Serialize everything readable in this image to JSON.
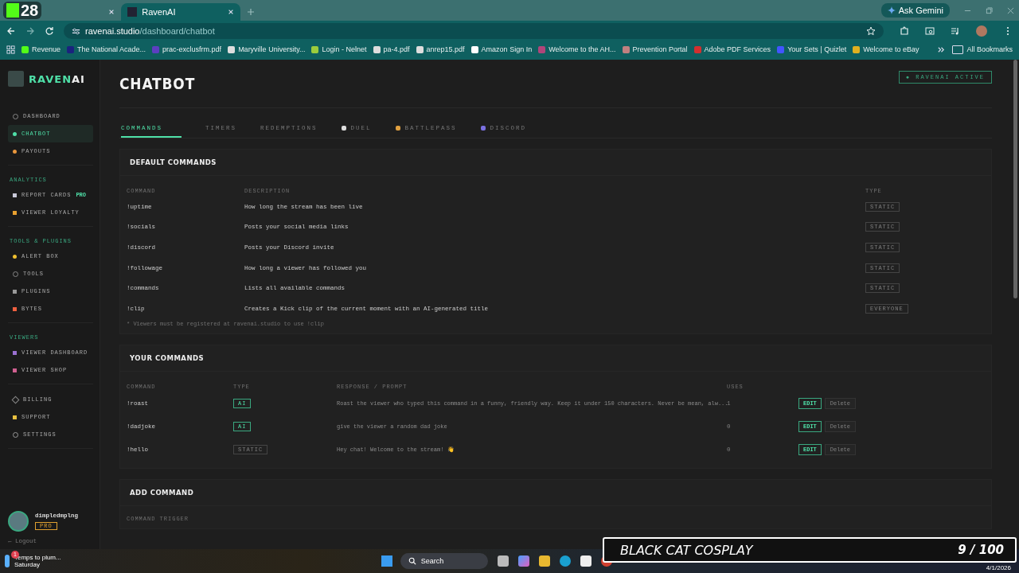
{
  "browser": {
    "tabs": [
      {
        "selected": false
      },
      {
        "title": "RavenAI",
        "selected": true
      }
    ],
    "url": {
      "host": "ravenai.studio",
      "path": "/dashboard/chatbot"
    },
    "ask_button": "Ask Gemini",
    "bookmarks": [
      "Revenue",
      "The National Acade...",
      "prac-exclusfrm.pdf",
      "Maryville University...",
      "Login - Nelnet",
      "pa-4.pdf",
      "anrep15.pdf",
      "Amazon Sign In",
      "Welcome to the AH...",
      "Prevention Portal",
      "Adobe PDF Services",
      "Your Sets | Quizlet",
      "Welcome to eBay"
    ],
    "all_bookmarks": "All Bookmarks"
  },
  "stream_badge": {
    "count": "28"
  },
  "sidebar": {
    "brand": {
      "part_1": "RAVEN",
      "part_2": "AI"
    },
    "sections": [
      {
        "items": [
          {
            "label": "DASHBOARD",
            "selected": false
          },
          {
            "label": "CHATBOT",
            "selected": true
          },
          {
            "label": "PAYOUTS",
            "selected": false
          }
        ]
      },
      {
        "heading": "ANALYTICS",
        "items": [
          {
            "label": "REPORT CARDS",
            "selected": false,
            "badge": "PRO"
          },
          {
            "label": "VIEWER LOYALTY",
            "selected": false
          }
        ]
      },
      {
        "heading": "TOOLS & PLUGINS",
        "items": [
          {
            "label": "ALERT BOX",
            "selected": false
          },
          {
            "label": "TOOLS",
            "selected": false
          },
          {
            "label": "PLUGINS",
            "selected": false
          },
          {
            "label": "BYTES",
            "selected": false
          }
        ]
      },
      {
        "heading": "VIEWERS",
        "items": [
          {
            "label": "VIEWER DASHBOARD",
            "selected": false
          },
          {
            "label": "VIEWER SHOP",
            "selected": false
          }
        ]
      },
      {
        "items": [
          {
            "label": "BILLING",
            "selected": false
          },
          {
            "label": "SUPPORT",
            "selected": false
          },
          {
            "label": "SETTINGS",
            "selected": false
          }
        ]
      }
    ],
    "user": {
      "name": "dimpledmplng",
      "plan": "PRO",
      "logout": "← Logout"
    }
  },
  "main": {
    "title": "CHATBOT",
    "status": "● RAVENAI ACTIVE",
    "tabs": [
      {
        "label": "COMMANDS",
        "selected": true
      },
      {
        "label": "TIMERS",
        "selected": false
      },
      {
        "label": "REDEMPTIONS",
        "selected": false
      },
      {
        "label": "DUEL",
        "selected": false
      },
      {
        "label": "BATTLEPASS",
        "selected": false
      },
      {
        "label": "DISCORD",
        "selected": false
      }
    ],
    "default_commands": {
      "title": "DEFAULT COMMANDS",
      "columns": [
        "COMMAND",
        "DESCRIPTION",
        "TYPE"
      ],
      "rows": [
        {
          "command": "!uptime",
          "description": "How long the stream has been live",
          "type": "STATIC"
        },
        {
          "command": "!socials",
          "description": "Posts your social media links",
          "type": "STATIC"
        },
        {
          "command": "!discord",
          "description": "Posts your Discord invite",
          "type": "STATIC"
        },
        {
          "command": "!followage",
          "description": "How long a viewer has followed you",
          "type": "STATIC"
        },
        {
          "command": "!commands",
          "description": "Lists all available commands",
          "type": "STATIC"
        },
        {
          "command": "!clip",
          "description": "Creates a Kick clip of the current moment with an AI-generated title",
          "type": "EVERYONE"
        }
      ],
      "note": "* Viewers must be registered at ravenai.studio to use !clip"
    },
    "your_commands": {
      "title": "YOUR COMMANDS",
      "columns": [
        "COMMAND",
        "TYPE",
        "RESPONSE / PROMPT",
        "USES"
      ],
      "rows": [
        {
          "command": "!roast",
          "type": "AI",
          "kind": "ai",
          "response": "Roast the viewer who typed this command in a funny, friendly way. Keep it under 150 characters. Never be mean, alw...",
          "uses": "1",
          "edit": "EDIT",
          "delete": "Delete"
        },
        {
          "command": "!dadjoke",
          "type": "AI",
          "kind": "ai",
          "response": "give the viewer a random dad joke",
          "uses": "0",
          "edit": "EDIT",
          "delete": "Delete"
        },
        {
          "command": "!hello",
          "type": "STATIC",
          "kind": "static",
          "response": "Hey chat! Welcome to the stream! 👋",
          "uses": "0",
          "edit": "EDIT",
          "delete": "Delete"
        }
      ]
    },
    "add_command": {
      "title": "ADD COMMAND",
      "field_label": "COMMAND TRIGGER"
    }
  },
  "taskbar": {
    "weather": {
      "title": "Temps to plum...",
      "subtitle": "Saturday",
      "count": "1"
    },
    "search": "Search",
    "date": "4/1/2026"
  },
  "stream_overlay": {
    "title": "BLACK CAT COSPLAY",
    "counter": "9 / 100"
  }
}
